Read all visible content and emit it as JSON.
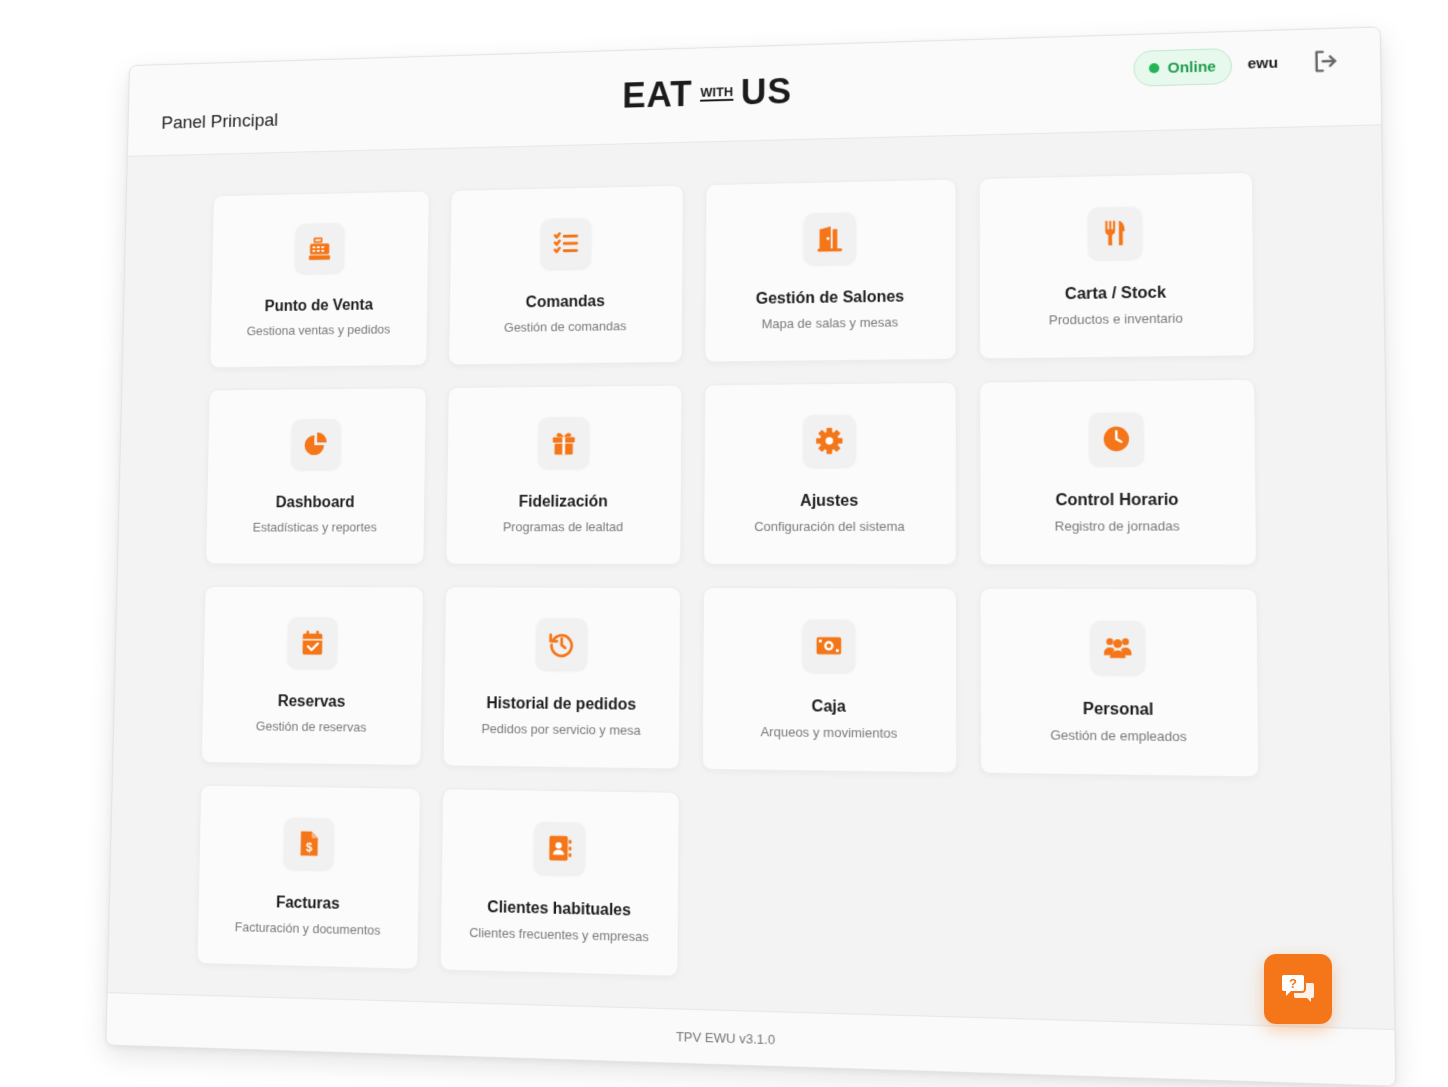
{
  "header": {
    "page_title": "Panel Principal",
    "logo": {
      "left": "EAT",
      "middle": "WITH",
      "right": "US"
    },
    "status": "Online",
    "username": "ewu"
  },
  "accent_color": "#f47619",
  "status_color": "#22b455",
  "cards": [
    {
      "title": "Punto de Venta",
      "subtitle": "Gestiona ventas y pedidos",
      "icon": "cash-register-icon"
    },
    {
      "title": "Comandas",
      "subtitle": "Gestión de comandas",
      "icon": "checklist-icon"
    },
    {
      "title": "Gestión de Salones",
      "subtitle": "Mapa de salas y mesas",
      "icon": "door-icon"
    },
    {
      "title": "Carta / Stock",
      "subtitle": "Productos e inventario",
      "icon": "utensils-icon"
    },
    {
      "title": "Dashboard",
      "subtitle": "Estadísticas y reportes",
      "icon": "pie-chart-icon"
    },
    {
      "title": "Fidelización",
      "subtitle": "Programas de lealtad",
      "icon": "gift-icon"
    },
    {
      "title": "Ajustes",
      "subtitle": "Configuración del sistema",
      "icon": "gear-icon"
    },
    {
      "title": "Control Horario",
      "subtitle": "Registro de jornadas",
      "icon": "clock-icon"
    },
    {
      "title": "Reservas",
      "subtitle": "Gestión de reservas",
      "icon": "calendar-check-icon"
    },
    {
      "title": "Historial de pedidos",
      "subtitle": "Pedidos por servicio y mesa",
      "icon": "history-icon"
    },
    {
      "title": "Caja",
      "subtitle": "Arqueos y movimientos",
      "icon": "money-bill-icon"
    },
    {
      "title": "Personal",
      "subtitle": "Gestión de empleados",
      "icon": "users-icon"
    },
    {
      "title": "Facturas",
      "subtitle": "Facturación y documentos",
      "icon": "invoice-dollar-icon"
    },
    {
      "title": "Clientes habituales",
      "subtitle": "Clientes frecuentes y empresas",
      "icon": "address-book-icon"
    }
  ],
  "footer": {
    "version": "TPV EWU v3.1.0"
  },
  "fab": {
    "icon": "chat-help-icon"
  }
}
